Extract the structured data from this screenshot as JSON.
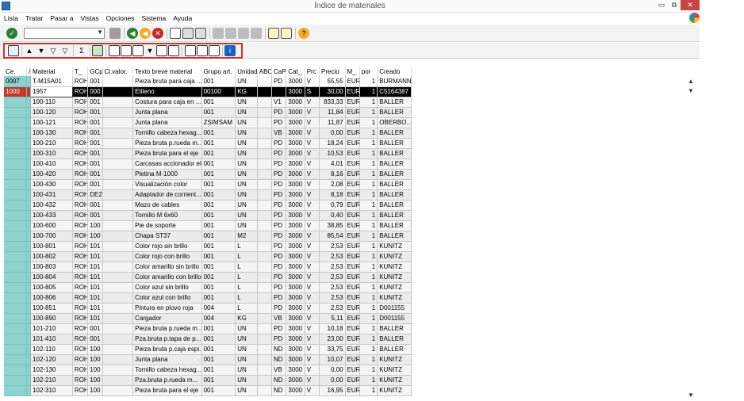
{
  "window": {
    "title": "Índice de materiales",
    "minimize": "▭",
    "maximize": "⧉",
    "close": "✕"
  },
  "menu": [
    "Lista",
    "Tratar",
    "Pasar a",
    "Vistas",
    "Opciones",
    "Sistema",
    "Ayuda"
  ],
  "command_field": {
    "value": "",
    "placeholder": ""
  },
  "columns": [
    "Ce.",
    "/",
    "Material",
    "T_",
    "GCp",
    "Cl.valor.",
    "Texto breve material",
    "Grupo art.",
    "Unidad",
    "ABC",
    "CaP",
    "Cat_",
    "Prc",
    "Precio",
    "M_",
    "por",
    "Creado"
  ],
  "rows": [
    [
      "0007",
      "",
      "T-M15A01",
      "ROH",
      "001",
      "",
      "Pieza bruta para caja ...",
      "001",
      "UN",
      "",
      "PD",
      "3000",
      "V",
      "55,55",
      "EUR",
      "1",
      "BURMANN"
    ],
    [
      "1000",
      "",
      "1957",
      "ROH",
      "000",
      "",
      "Etileno",
      "00100",
      "KG",
      "",
      "",
      "3000",
      "S",
      "30,00",
      "EUR",
      "1",
      "C5164387"
    ],
    [
      "",
      "",
      "100-110",
      "ROH",
      "001",
      "",
      "Costura para caja en ...",
      "001",
      "UN",
      "",
      "V1",
      "3000",
      "V",
      "833,33",
      "EUR",
      "1",
      "BALLER"
    ],
    [
      "",
      "",
      "100-120",
      "ROH",
      "001",
      "",
      "Junta plana",
      "001",
      "UN",
      "",
      "PD",
      "3000",
      "V",
      "11,84",
      "EUR",
      "1",
      "BALLER"
    ],
    [
      "",
      "",
      "100-121",
      "ROH",
      "001",
      "",
      "Junta plana",
      "ZSIMSAM",
      "UN",
      "",
      "PD",
      "3000",
      "V",
      "11,87",
      "EUR",
      "1",
      "OBERBO..."
    ],
    [
      "",
      "",
      "100-130",
      "ROH",
      "001",
      "",
      "Tornillo cabeza hexag...",
      "001",
      "UN",
      "",
      "VB",
      "3000",
      "V",
      "0,00",
      "EUR",
      "1",
      "BALLER"
    ],
    [
      "",
      "",
      "100-210",
      "ROH",
      "001",
      "",
      "Pieza bruta p.rueda m...",
      "001",
      "UN",
      "",
      "PD",
      "3000",
      "V",
      "18,24",
      "EUR",
      "1",
      "BALLER"
    ],
    [
      "",
      "",
      "100-310",
      "ROH",
      "001",
      "",
      "Pieza bruta para el eje",
      "001",
      "UN",
      "",
      "PD",
      "3000",
      "V",
      "10,53",
      "EUR",
      "1",
      "BALLER"
    ],
    [
      "",
      "",
      "100-410",
      "ROH",
      "001",
      "",
      "Carcasas accionador el...",
      "001",
      "UN",
      "",
      "PD",
      "3000",
      "V",
      "4,01",
      "EUR",
      "1",
      "BALLER"
    ],
    [
      "",
      "",
      "100-420",
      "ROH",
      "001",
      "",
      "Pletina M-1000",
      "001",
      "UN",
      "",
      "PD",
      "3000",
      "V",
      "8,16",
      "EUR",
      "1",
      "BALLER"
    ],
    [
      "",
      "",
      "100-430",
      "ROH",
      "001",
      "",
      "Visualización color",
      "001",
      "UN",
      "",
      "PD",
      "3000",
      "V",
      "2,08",
      "EUR",
      "1",
      "BALLER"
    ],
    [
      "",
      "",
      "100-431",
      "ROH",
      "DE2",
      "",
      "Adaptador de corrient...",
      "001",
      "UN",
      "",
      "PD",
      "3000",
      "V",
      "8,18",
      "EUR",
      "1",
      "BALLER"
    ],
    [
      "",
      "",
      "100-432",
      "ROH",
      "001",
      "",
      "Mazo de cables",
      "001",
      "UN",
      "",
      "PD",
      "3000",
      "V",
      "0,79",
      "EUR",
      "1",
      "BALLER"
    ],
    [
      "",
      "",
      "100-433",
      "ROH",
      "001",
      "",
      "Tornillo M 6x60",
      "001",
      "UN",
      "",
      "PD",
      "3000",
      "V",
      "0,40",
      "EUR",
      "1",
      "BALLER"
    ],
    [
      "",
      "",
      "100-600",
      "ROH",
      "100",
      "",
      "Pie de soporte",
      "001",
      "UN",
      "",
      "PD",
      "3000",
      "V",
      "38,85",
      "EUR",
      "1",
      "BALLER"
    ],
    [
      "",
      "",
      "100-700",
      "ROH",
      "100",
      "",
      "Chapa ST37",
      "001",
      "M2",
      "",
      "PD",
      "3000",
      "V",
      "85,54",
      "EUR",
      "1",
      "BALLER"
    ],
    [
      "",
      "",
      "100-801",
      "ROH",
      "101",
      "",
      "Color rojo sin brillo",
      "001",
      "L",
      "",
      "PD",
      "3000",
      "V",
      "2,53",
      "EUR",
      "1",
      "KUNITZ"
    ],
    [
      "",
      "",
      "100-802",
      "ROH",
      "101",
      "",
      "Color rojo con brillo",
      "001",
      "L",
      "",
      "PD",
      "3000",
      "V",
      "2,53",
      "EUR",
      "1",
      "KUNITZ"
    ],
    [
      "",
      "",
      "100-803",
      "ROH",
      "101",
      "",
      "Color amarillo sin brillo",
      "001",
      "L",
      "",
      "PD",
      "3000",
      "V",
      "2,53",
      "EUR",
      "1",
      "KUNITZ"
    ],
    [
      "",
      "",
      "100-804",
      "ROH",
      "101",
      "",
      "Color amarillo con brillo",
      "001",
      "L",
      "",
      "PD",
      "3000",
      "V",
      "2,53",
      "EUR",
      "1",
      "KUNITZ"
    ],
    [
      "",
      "",
      "100-805",
      "ROH",
      "101",
      "",
      "Color azul sin brillo",
      "001",
      "L",
      "",
      "PD",
      "3000",
      "V",
      "2,53",
      "EUR",
      "1",
      "KUNITZ"
    ],
    [
      "",
      "",
      "100-806",
      "ROH",
      "101",
      "",
      "Color azul con brillo",
      "001",
      "L",
      "",
      "PD",
      "3000",
      "V",
      "2,53",
      "EUR",
      "1",
      "KUNITZ"
    ],
    [
      "",
      "",
      "100-851",
      "ROH",
      "101",
      "",
      "Pintura en plovo roja",
      "004",
      "L",
      "",
      "PD",
      "3000",
      "V",
      "2,53",
      "EUR",
      "1",
      "D001155"
    ],
    [
      "",
      "",
      "100-890",
      "ROH",
      "101",
      "",
      "Cargador",
      "004",
      "KG",
      "",
      "VB",
      "3000",
      "V",
      "5,11",
      "EUR",
      "1",
      "D001155"
    ],
    [
      "",
      "",
      "101-210",
      "ROH",
      "001",
      "",
      "Pieza bruta p.rueda m...",
      "001",
      "UN",
      "",
      "PD",
      "3000",
      "V",
      "10,18",
      "EUR",
      "1",
      "BALLER"
    ],
    [
      "",
      "",
      "101-410",
      "ROH",
      "001",
      "",
      "Pza.bruta p.tapa de p...",
      "001",
      "UN",
      "",
      "PD",
      "3000",
      "V",
      "23,00",
      "EUR",
      "1",
      "BALLER"
    ],
    [
      "",
      "",
      "102-110",
      "ROH",
      "100",
      "",
      "Pieza bruta p.caja espi...",
      "001",
      "UN",
      "",
      "ND",
      "3000",
      "V",
      "33,75",
      "EUR",
      "1",
      "BALLER"
    ],
    [
      "",
      "",
      "102-120",
      "ROH",
      "100",
      "",
      "Junta plana",
      "001",
      "UN",
      "",
      "ND",
      "3000",
      "V",
      "10,07",
      "EUR",
      "1",
      "KUNITZ"
    ],
    [
      "",
      "",
      "102-130",
      "ROH",
      "100",
      "",
      "Tornillo cabeza hexag...",
      "001",
      "UN",
      "",
      "VB",
      "3000",
      "V",
      "0,00",
      "EUR",
      "1",
      "KUNITZ"
    ],
    [
      "",
      "",
      "102-210",
      "ROH",
      "100",
      "",
      "Pza.bruta p.rueda m...",
      "001",
      "UN",
      "",
      "ND",
      "3000",
      "V",
      "0,00",
      "EUR",
      "1",
      "KUNITZ"
    ],
    [
      "",
      "",
      "102-310",
      "ROH",
      "100",
      "",
      "Pieza bruta para el eje",
      "001",
      "UN",
      "",
      "ND",
      "3000",
      "V",
      "16,95",
      "EUR",
      "1",
      "KUNITZ"
    ]
  ]
}
